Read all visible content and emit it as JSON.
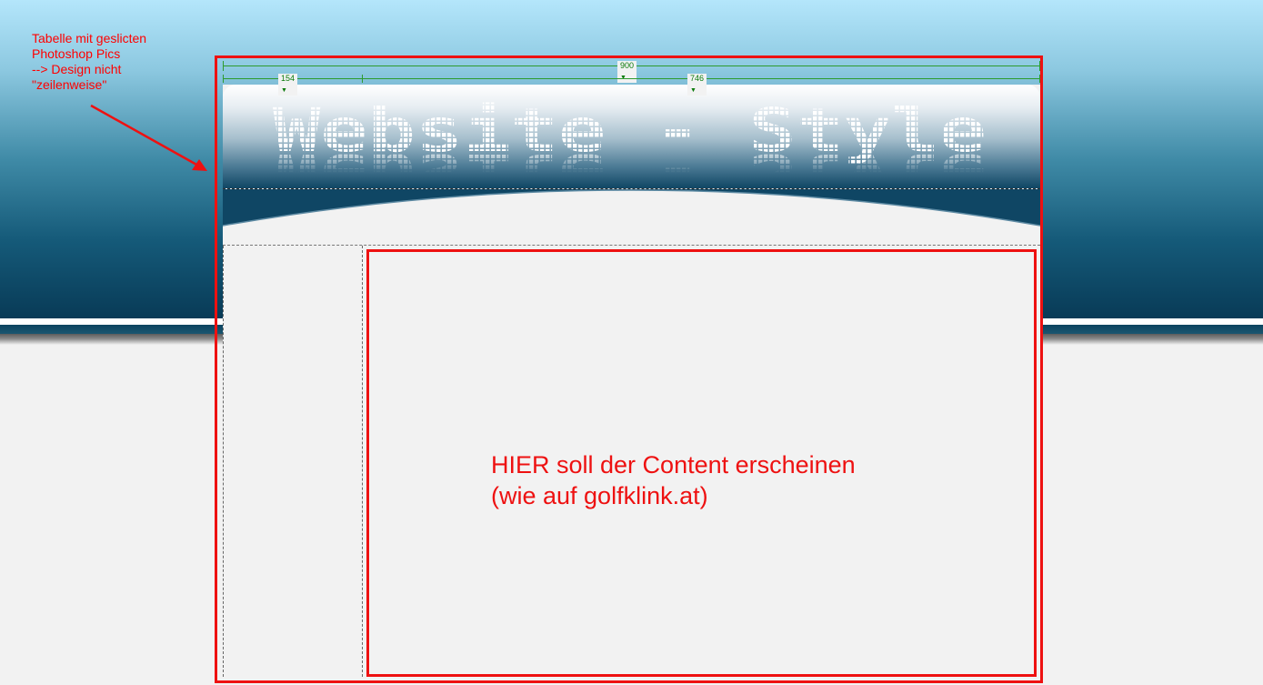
{
  "annotation": {
    "lines": [
      "Tabelle mit geslicten",
      "Photoshop Pics",
      "--> Design nicht",
      "\"zeilenweise\""
    ],
    "color": "#ff0000"
  },
  "ruler": {
    "total_width": "900",
    "sidebar_width": "154",
    "main_width": "746",
    "color": "#2e9b2e"
  },
  "header": {
    "logo_text": "Website - Style"
  },
  "content": {
    "line1": "HIER soll der Content erscheinen",
    "line2": "(wie auf golfklink.at)"
  },
  "colors": {
    "annotation_red": "#ee1111",
    "background_top": "#b4e6fb",
    "background_dark": "#083a56",
    "page_bg": "#f2f2f2"
  }
}
